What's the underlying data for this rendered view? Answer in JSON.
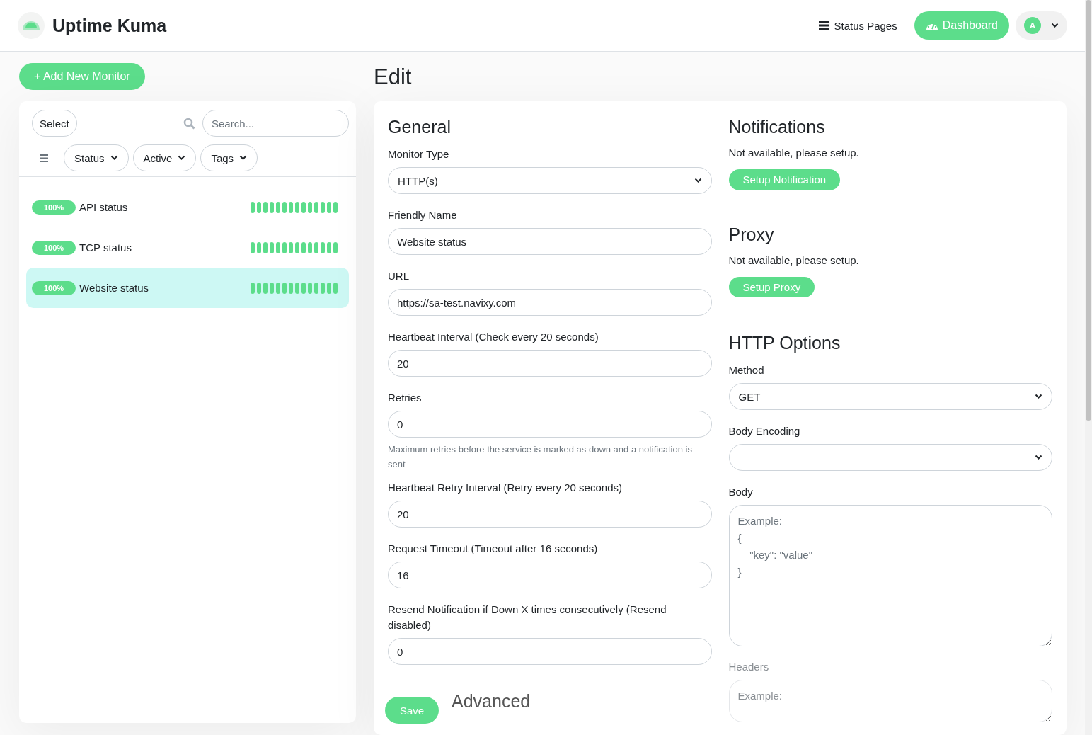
{
  "header": {
    "brand": "Uptime Kuma",
    "nav": [
      {
        "label": "Status Pages",
        "kind": "link"
      },
      {
        "label": "Dashboard",
        "kind": "primary"
      }
    ],
    "avatar": "A"
  },
  "sidebar": {
    "add_button": "+ Add New Monitor",
    "select_button": "Select",
    "search": {
      "placeholder": "Search..."
    },
    "filters": [
      {
        "label": "Status"
      },
      {
        "label": "Active"
      },
      {
        "label": "Tags"
      }
    ],
    "monitors": [
      {
        "uptime": "100%",
        "name": "API status",
        "selected": false
      },
      {
        "uptime": "100%",
        "name": "TCP status",
        "selected": false
      },
      {
        "uptime": "100%",
        "name": "Website status",
        "selected": true
      }
    ]
  },
  "page_title": "Edit",
  "general": {
    "title": "General",
    "fields": [
      {
        "label": "Monitor Type",
        "kind": "select",
        "value": "HTTP(s)"
      },
      {
        "label": "Friendly Name",
        "kind": "input",
        "value": "Website status"
      },
      {
        "label": "URL",
        "kind": "input",
        "value": "https://sa-test.navixy.com"
      },
      {
        "label": "Heartbeat Interval (Check every 20 seconds)",
        "kind": "input",
        "value": "20"
      },
      {
        "label": "Retries",
        "kind": "input",
        "value": "0",
        "hint": "Maximum retries before the service is marked as down and a notification is sent"
      },
      {
        "label": "Heartbeat Retry Interval (Retry every 20 seconds)",
        "kind": "input",
        "value": "20"
      },
      {
        "label": "Request Timeout (Timeout after 16 seconds)",
        "kind": "input",
        "value": "16"
      },
      {
        "label": "Resend Notification if Down X times consecutively (Resend disabled)",
        "kind": "input",
        "value": "0"
      }
    ],
    "next_section": "Advanced",
    "save_button": "Save"
  },
  "notifications": {
    "title": "Notifications",
    "text": "Not available, please setup.",
    "button": "Setup Notification"
  },
  "proxy": {
    "title": "Proxy",
    "text": "Not available, please setup.",
    "button": "Setup Proxy"
  },
  "http_options": {
    "title": "HTTP Options",
    "fields": [
      {
        "label": "Method",
        "kind": "select",
        "value": "GET"
      },
      {
        "label": "Body Encoding",
        "kind": "select"
      },
      {
        "label": "Body",
        "kind": "textarea",
        "placeholder": "Example:\n{\n    \"key\": \"value\"\n}"
      }
    ],
    "faded_field": {
      "label": "Headers",
      "placeholder": "Example:"
    }
  }
}
